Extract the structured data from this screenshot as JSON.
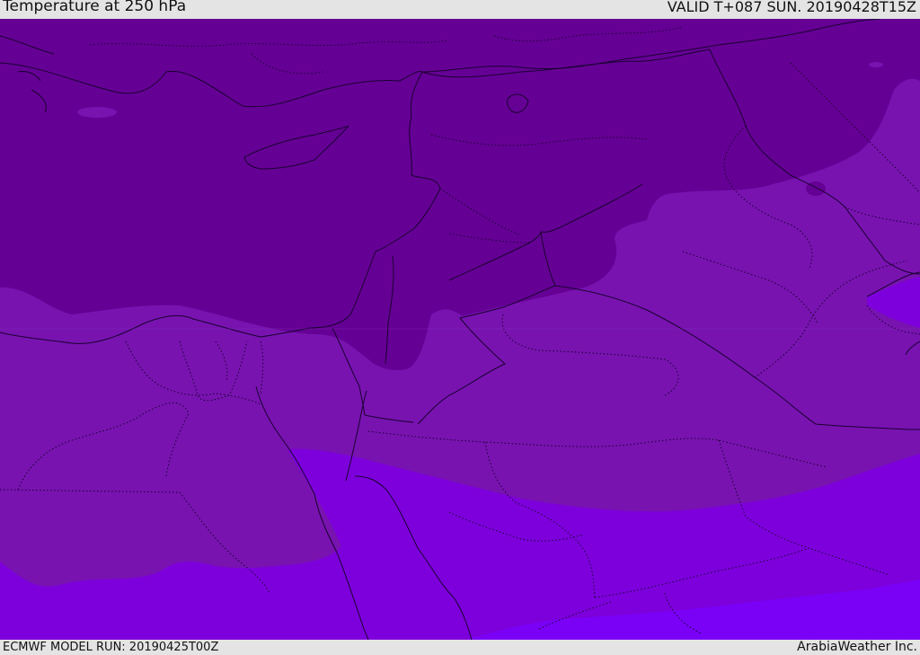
{
  "header": {
    "title": "Temperature at 250 hPa",
    "valid": "VALID T+087 SUN. 20190428T15Z"
  },
  "footer": {
    "model_run": "ECMWF MODEL RUN: 20190425T00Z",
    "credit": "ArabiaWeather Inc."
  },
  "map": {
    "colors": {
      "band_coldest": "#650095",
      "band_cold": "#7813b0",
      "band_mid": "#7d00dc",
      "band_warm": "#7a00f6",
      "coast": "#1a0030",
      "border": "#1a0030"
    },
    "icons": {
      "coastline": "solid-line",
      "national_border": "solid-line",
      "province_border": "dotted-line"
    }
  }
}
